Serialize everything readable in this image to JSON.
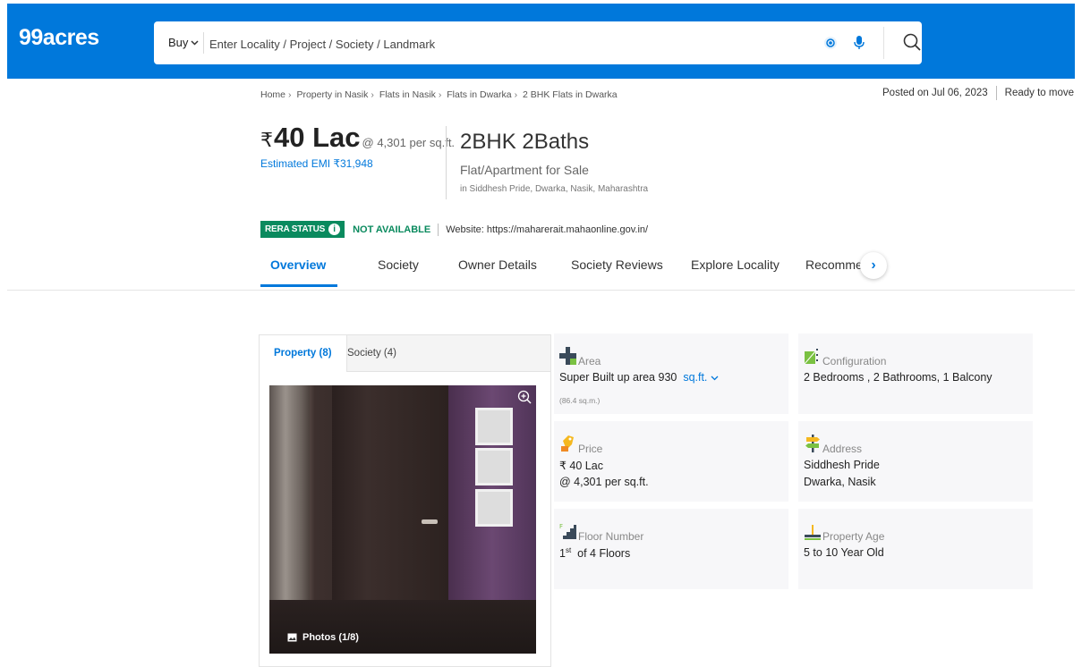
{
  "header": {
    "logo": "99acres",
    "buy_label": "Buy",
    "search_placeholder": "Enter Locality / Project / Society / Landmark",
    "brand_color": "#0078db"
  },
  "listing": {
    "breadcrumb": [
      "Home",
      "Property in Nasik",
      "Flats in Nasik",
      "Flats in Dwarka",
      "2 BHK Flats in Dwarka"
    ],
    "posted": "Posted on Jul 06, 2023",
    "status": "Ready to move",
    "price_symbol": "₹",
    "price": "40 Lac",
    "price_per_sqft": "@ 4,301 per sq.ft.",
    "emi": "Estimated EMI ₹31,948",
    "config_title": "2BHK 2Baths",
    "config_sub": "Flat/Apartment for Sale",
    "location": "in Siddhesh Pride, Dwarka, Nasik, Maharashtra",
    "rera_label": "RERA STATUS",
    "rera_value": "NOT AVAILABLE",
    "rera_website": "Website: https://maharerait.mahaonline.gov.in/"
  },
  "tabs": [
    {
      "label": "Overview"
    },
    {
      "label": "Society"
    },
    {
      "label": "Owner Details"
    },
    {
      "label": "Society Reviews"
    },
    {
      "label": "Explore Locality"
    },
    {
      "label": "Recommend"
    }
  ],
  "gallery": {
    "tabs": [
      {
        "label": "Property (8)"
      },
      {
        "label": "Society (4)"
      }
    ],
    "photos_label": "Photos (1/8)"
  },
  "details": {
    "area": {
      "label": "Area",
      "value": "Super Built up area 930",
      "unit": "sq.ft.",
      "sub": "(86.4 sq.m.)"
    },
    "configuration": {
      "label": "Configuration",
      "value": "2 Bedrooms , 2 Bathrooms, 1 Balcony"
    },
    "price": {
      "label": "Price",
      "value": "₹ 40 Lac",
      "value2": "@ 4,301 per sq.ft."
    },
    "address": {
      "label": "Address",
      "value": "Siddhesh Pride",
      "value2": "Dwarka, Nasik"
    },
    "floor": {
      "label": "Floor Number",
      "value_num": "1",
      "value_sup": "st",
      "value_rest": "of 4 Floors"
    },
    "age": {
      "label": "Property Age",
      "value": "5 to 10 Year Old"
    }
  }
}
